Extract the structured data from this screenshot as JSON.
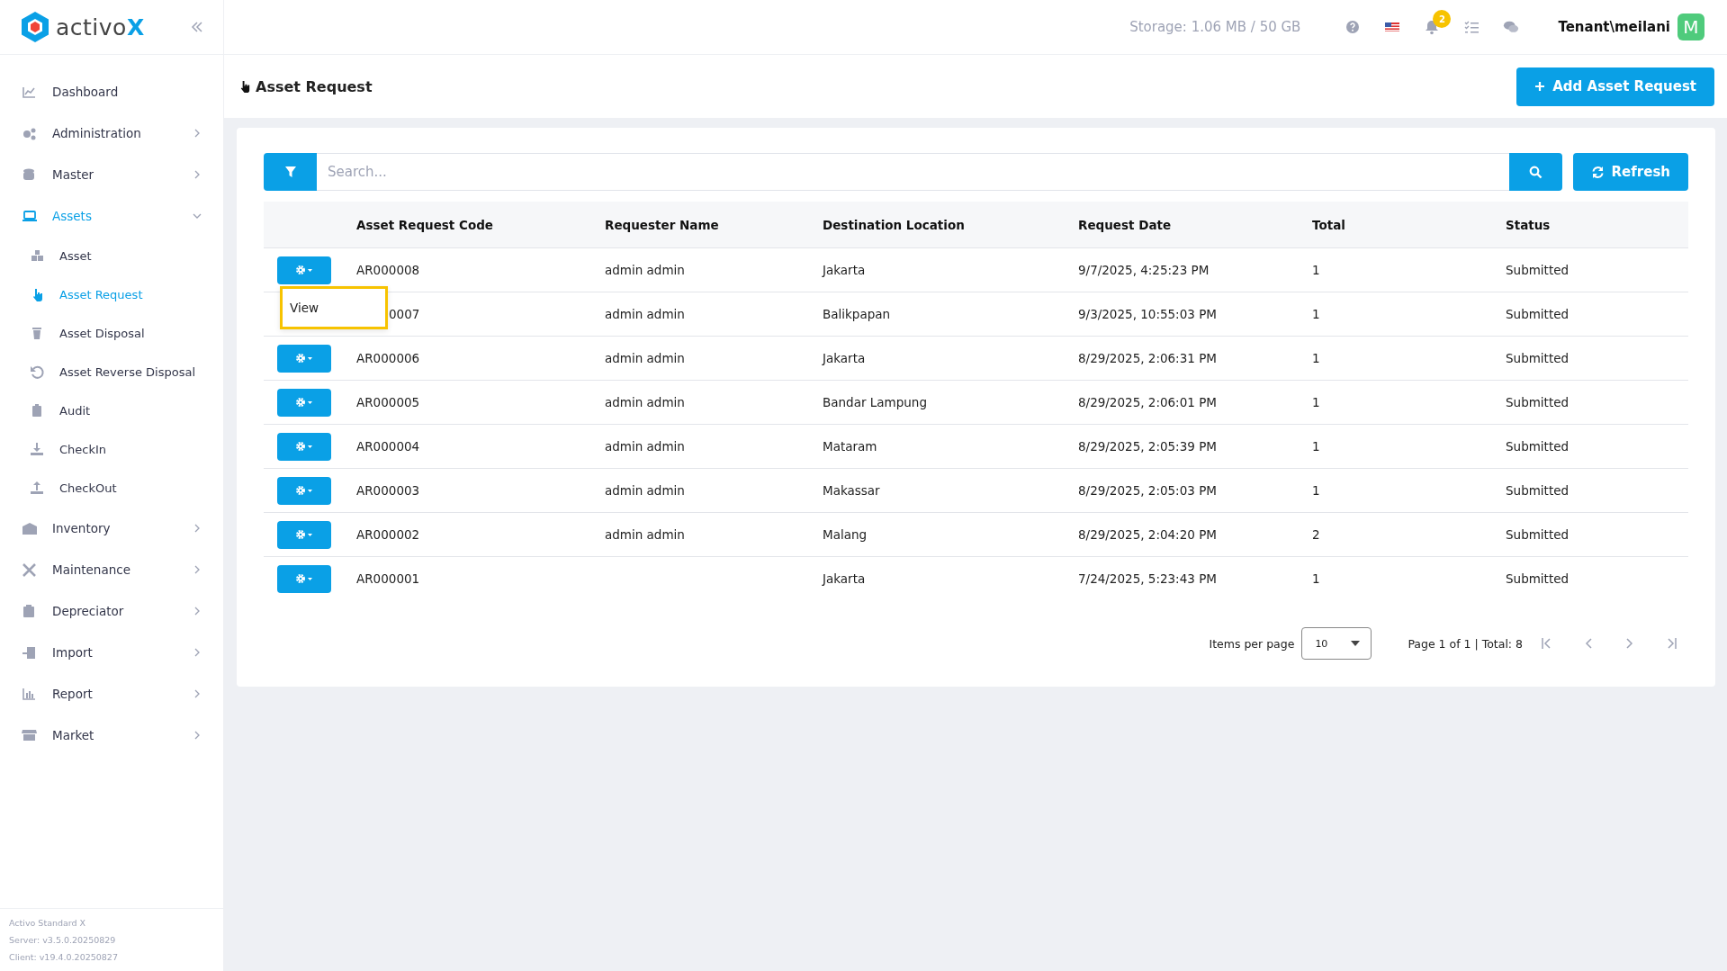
{
  "brand": {
    "name": "activo",
    "mark": "X"
  },
  "sidebar": {
    "items": [
      {
        "label": "Dashboard",
        "selected": false
      },
      {
        "label": "Administration",
        "selected": false,
        "expanded": false
      },
      {
        "label": "Master",
        "selected": false,
        "expanded": false
      },
      {
        "label": "Assets",
        "selected": true,
        "expanded": true,
        "children": [
          {
            "label": "Asset",
            "selected": false
          },
          {
            "label": "Asset Request",
            "selected": true
          },
          {
            "label": "Asset Disposal",
            "selected": false
          },
          {
            "label": "Asset Reverse Disposal",
            "selected": false
          },
          {
            "label": "Audit",
            "selected": false
          },
          {
            "label": "CheckIn",
            "selected": false
          },
          {
            "label": "CheckOut",
            "selected": false
          }
        ]
      },
      {
        "label": "Inventory",
        "selected": false,
        "expanded": false
      },
      {
        "label": "Maintenance",
        "selected": false,
        "expanded": false
      },
      {
        "label": "Depreciator",
        "selected": false,
        "expanded": false
      },
      {
        "label": "Import",
        "selected": false,
        "expanded": false
      },
      {
        "label": "Report",
        "selected": false,
        "expanded": false
      },
      {
        "label": "Market",
        "selected": false,
        "expanded": false
      }
    ],
    "footer": [
      "Activo Standard X",
      "Server: v3.5.0.20250829",
      "Client: v19.4.0.20250827"
    ]
  },
  "header": {
    "storage": "Storage: 1.06 MB / 50 GB",
    "notification_count": "2",
    "user": "Tenant\\meilani",
    "avatar": "M"
  },
  "page": {
    "title": "Asset Request",
    "add_button": "Add Asset Request"
  },
  "search": {
    "placeholder": "Search...",
    "refresh_button": "Refresh"
  },
  "table": {
    "columns": [
      "Asset Request Code",
      "Requester Name",
      "Destination Location",
      "Request Date",
      "Total",
      "Status"
    ],
    "rows": [
      {
        "code": "AR000008",
        "requester": "admin admin",
        "destination": "Jakarta",
        "date": "9/7/2025, 4:25:23 PM",
        "total": "1",
        "status": "Submitted",
        "covered": false,
        "menu": [
          "View"
        ]
      },
      {
        "code": "0007",
        "requester": "admin admin",
        "destination": "Balikpapan",
        "date": "9/3/2025, 10:55:03 PM",
        "total": "1",
        "status": "Submitted",
        "covered": true
      },
      {
        "code": "AR000006",
        "requester": "admin admin",
        "destination": "Jakarta",
        "date": "8/29/2025, 2:06:31 PM",
        "total": "1",
        "status": "Submitted",
        "covered": false
      },
      {
        "code": "AR000005",
        "requester": "admin admin",
        "destination": "Bandar Lampung",
        "date": "8/29/2025, 2:06:01 PM",
        "total": "1",
        "status": "Submitted",
        "covered": false
      },
      {
        "code": "AR000004",
        "requester": "admin admin",
        "destination": "Mataram",
        "date": "8/29/2025, 2:05:39 PM",
        "total": "1",
        "status": "Submitted",
        "covered": false
      },
      {
        "code": "AR000003",
        "requester": "admin admin",
        "destination": "Makassar",
        "date": "8/29/2025, 2:05:03 PM",
        "total": "1",
        "status": "Submitted",
        "covered": false
      },
      {
        "code": "AR000002",
        "requester": "admin admin",
        "destination": "Malang",
        "date": "8/29/2025, 2:04:20 PM",
        "total": "2",
        "status": "Submitted",
        "covered": false
      },
      {
        "code": "AR000001",
        "destination": "Jakarta",
        "date": "7/24/2025, 5:23:43 PM",
        "total": "1",
        "status": "Submitted",
        "covered": false
      }
    ]
  },
  "pagination": {
    "items_per_page_label": "Items per page",
    "items_per_page": "10",
    "summary": "Page 1 of 1 | Total: 8"
  }
}
